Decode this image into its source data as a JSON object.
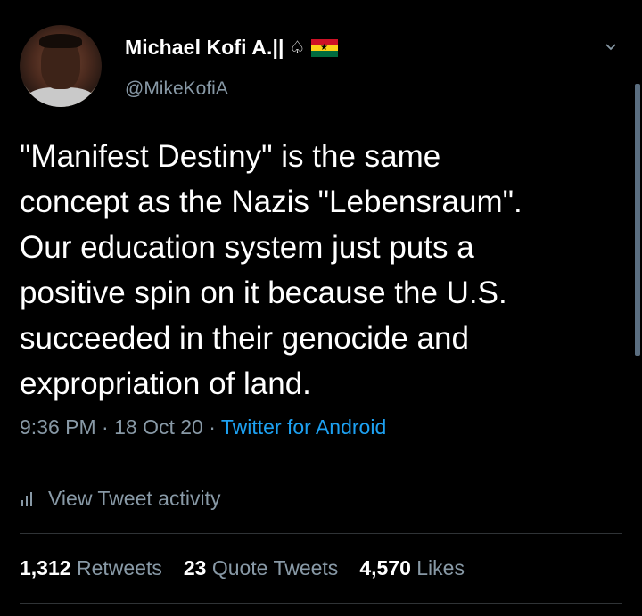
{
  "user": {
    "display_name": "Michael Kofi A.||",
    "spade_symbol": "♤",
    "flag_star": "★",
    "handle": "@MikeKofiA"
  },
  "tweet": {
    "text": "\"Manifest Destiny\" is the same\nconcept as the Nazis \"Lebensraum\".\nOur education system just puts a\npositive spin on it because the U.S.\nsucceeded in their genocide and\nexpropriation of land.",
    "time": "9:36 PM",
    "separator1": " · ",
    "date": "18 Oct 20",
    "separator2": " · ",
    "source": "Twitter for Android"
  },
  "activity": {
    "label": "View Tweet activity"
  },
  "stats": {
    "retweets_count": "1,312",
    "retweets_label": "Retweets",
    "quotes_count": "23",
    "quotes_label": "Quote Tweets",
    "likes_count": "4,570",
    "likes_label": "Likes"
  },
  "colors": {
    "background": "#000000",
    "secondary_text": "#8899a6",
    "link": "#1da1f2",
    "divider": "#2f3336"
  }
}
